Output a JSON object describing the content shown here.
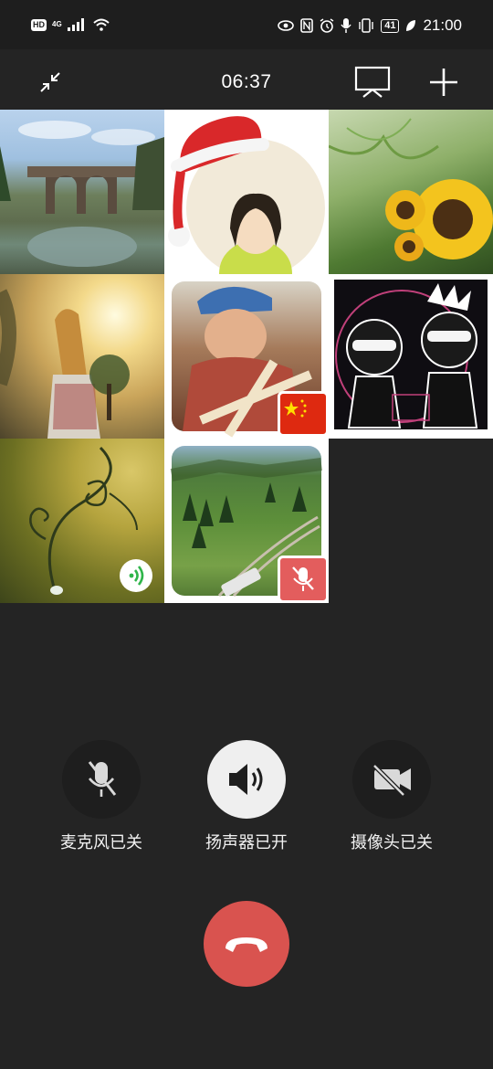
{
  "status_bar": {
    "hd_label": "HD",
    "network_label": "4G",
    "battery_level": "41",
    "time": "21:00",
    "icons": [
      "eye-icon",
      "nfc-icon",
      "alarm-icon",
      "mic-icon",
      "vibrate-icon",
      "battery-icon",
      "leaf-icon"
    ]
  },
  "call": {
    "duration": "06:37",
    "icons": {
      "minimize": "minimize-icon",
      "screen_share": "screen-share-icon",
      "add": "plus-icon"
    }
  },
  "participants": [
    {
      "name": "bridge-landscape",
      "muted": false,
      "speaking": false
    },
    {
      "name": "santa-hat-avatar",
      "muted": false,
      "speaking": false
    },
    {
      "name": "sunflower-photo",
      "muted": false,
      "speaking": false
    },
    {
      "name": "sunset-girl-photo",
      "muted": false,
      "speaking": false
    },
    {
      "name": "child-with-flag-photo",
      "muted": false,
      "speaking": false,
      "flag": "china-flag"
    },
    {
      "name": "cartoon-duo-photo",
      "muted": false,
      "speaking": false
    },
    {
      "name": "vine-tendril-photo",
      "muted": false,
      "speaking": true
    },
    {
      "name": "railway-valley-photo",
      "muted": true,
      "speaking": false
    }
  ],
  "controls": {
    "microphone": {
      "label": "麦克风已关",
      "state": "off",
      "icon": "mic-off-icon"
    },
    "speaker": {
      "label": "扬声器已开",
      "state": "on",
      "icon": "speaker-icon"
    },
    "camera": {
      "label": "摄像头已关",
      "state": "off",
      "icon": "camera-off-icon"
    },
    "hangup": {
      "icon": "hangup-icon"
    }
  },
  "colors": {
    "background": "#242424",
    "hangup": "#d9534f",
    "speaker_active": "#efefef",
    "control_inactive": "#1e1e1e",
    "speaking_green": "#2fb54a",
    "muted_red": "#e35d5d"
  }
}
